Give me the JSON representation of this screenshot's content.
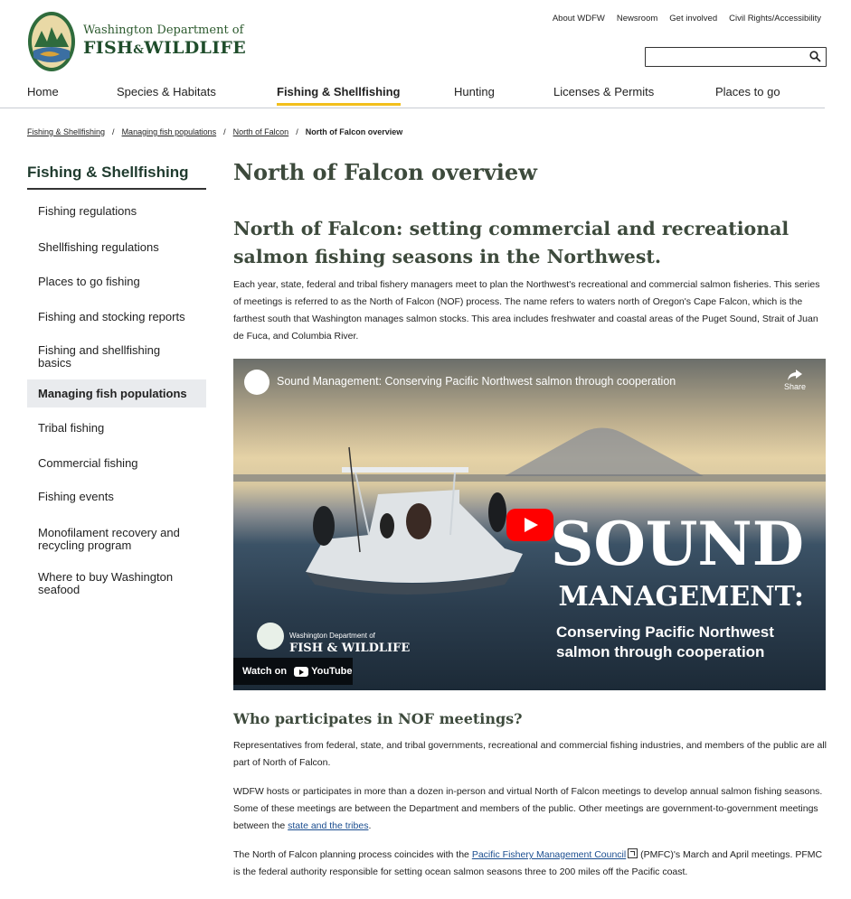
{
  "header": {
    "brand_line1": "Washington Department of",
    "brand_line2": "FISH",
    "brand_amp": "&",
    "brand_line3": "WILDLIFE",
    "utility_links": [
      "About WDFW",
      "Newsroom",
      "Get involved",
      "Civil Rights/Accessibility"
    ],
    "search_value": ""
  },
  "nav": {
    "items": [
      "Home",
      "Species & Habitats",
      "Fishing & Shellfishing",
      "Hunting",
      "Licenses & Permits",
      "Places to go"
    ],
    "active": "Fishing & Shellfishing"
  },
  "breadcrumb": {
    "items": [
      "Fishing & Shellfishing",
      "Managing fish populations",
      "North of Falcon"
    ],
    "current": "North of Falcon overview",
    "separator": "/"
  },
  "sidebar": {
    "title": "Fishing & Shellfishing",
    "items": [
      "Fishing regulations",
      "Shellfishing regulations",
      "Places to go fishing",
      "Fishing and stocking reports",
      "Fishing and shellfishing basics",
      "Managing fish populations",
      "Tribal fishing",
      "Commercial fishing",
      "Fishing events",
      "Monofilament recovery and recycling program",
      "Where to buy Washington seafood"
    ],
    "active": "Managing fish populations"
  },
  "main": {
    "title": "North of Falcon overview",
    "subheading": "North of Falcon: setting commercial and recreational salmon fishing seasons in the Northwest.",
    "intro": "Each year, state, federal and tribal fishery managers meet to plan the Northwest's recreational and commercial salmon fisheries. This series of meetings is referred to as the North of Falcon (NOF) process. The name refers to waters north of Oregon's Cape Falcon, which is the farthest south that Washington manages salmon stocks. This area includes freshwater and coastal areas of the Puget Sound, Strait of Juan de Fuca, and Columbia River.",
    "video": {
      "title": "Sound Management: Conserving Pacific Northwest salmon through cooperation",
      "share": "Share",
      "overlay_big": "SOUND",
      "overlay_mid": "MANAGEMENT:",
      "overlay_small": "Conserving Pacific Northwest salmon through cooperation",
      "watermark_line1": "Washington Department of",
      "watermark_line2": "FISH & WILDLIFE",
      "watch_on": "Watch on",
      "youtube": "YouTube"
    },
    "section_heading": "Who participates in NOF meetings?",
    "para1": "Representatives from federal, state, and tribal governments, recreational and commercial fishing industries, and members of the public are all part of North of Falcon.",
    "para2_text": "WDFW hosts or participates in more than a dozen in-person and virtual North of Falcon meetings to develop annual salmon fishing seasons. Some of these meetings are between the Department and members of the public. Other meetings are government-to-government meetings between the ",
    "para2_link": "state and the tribes",
    "para2_end": ".",
    "para3_start": "The North of Falcon planning process coincides with the ",
    "para3_link": "Pacific Fishery Management Council",
    "para3_rest": " (PMFC)'s March and April meetings. PFMC is the federal authority responsible for setting ocean salmon seasons three to 200 miles off the Pacific coast."
  }
}
